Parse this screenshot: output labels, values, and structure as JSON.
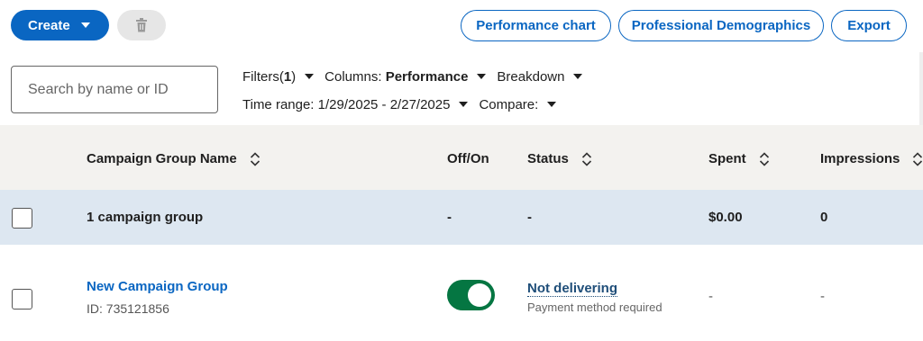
{
  "toolbar": {
    "create_label": "Create",
    "performance_chart_label": "Performance chart",
    "professional_demographics_label": "Professional Demographics",
    "export_label": "Export"
  },
  "search": {
    "placeholder": "Search by name or ID"
  },
  "filters": {
    "filters_label": "Filters(",
    "filters_count": "1",
    "filters_close": ")",
    "columns_label": "Columns:",
    "columns_value": "Performance",
    "breakdown_label": "Breakdown",
    "time_range_label": "Time range:",
    "time_range_value": "1/29/2025 - 2/27/2025",
    "compare_label": "Compare:"
  },
  "table": {
    "headers": {
      "name": "Campaign Group Name",
      "off_on": "Off/On",
      "status": "Status",
      "spent": "Spent",
      "impressions": "Impressions"
    },
    "summary": {
      "name": "1 campaign group",
      "off_on": "-",
      "status": "-",
      "spent": "$0.00",
      "impressions": "0"
    },
    "rows": [
      {
        "name": "New Campaign Group",
        "id": "ID: 735121856",
        "toggle_on": true,
        "status": "Not delivering",
        "status_detail": "Payment method required",
        "spent": "-",
        "impressions": "-"
      }
    ]
  },
  "colors": {
    "accent": "#0a66c2",
    "toggle_on": "#057642",
    "summary_bg": "#dde7f1",
    "header_bg": "#f3f2ef"
  }
}
